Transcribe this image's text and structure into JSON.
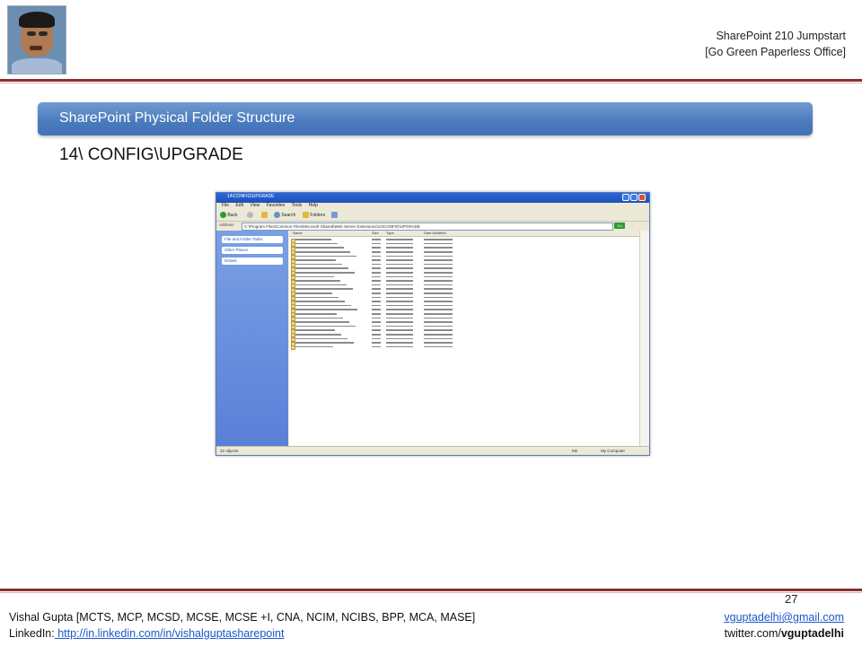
{
  "header": {
    "title_line1": "SharePoint 210 Jumpstart",
    "title_line2": "[Go Green Paperless Office]"
  },
  "slide": {
    "banner": "SharePoint Physical Folder Structure",
    "subheading": "14\\ CONFIG\\UPGRADE"
  },
  "explorer": {
    "title": "14\\CONFIG\\UPGRADE",
    "menu": [
      "File",
      "Edit",
      "View",
      "Favorites",
      "Tools",
      "Help"
    ],
    "toolbar": {
      "back": "Back",
      "search": "Search",
      "folders": "Folders"
    },
    "address_label": "Address",
    "address": "C:\\Program Files\\Common Files\\Microsoft Shared\\Web Server Extensions\\14\\CONFIG\\UPGRADE",
    "go_label": "Go",
    "tasks": [
      "File and Folder Tasks",
      "Other Places",
      "Details"
    ],
    "columns": [
      "Name",
      "Size",
      "Type",
      "Date Modified"
    ],
    "status_left": "22 objects",
    "status_mid": "KB",
    "status_right": "My Computer"
  },
  "footer": {
    "page_number": "27",
    "name_line": "Vishal Gupta [MCTS, MCP, MCSD, MCSE, MCSE +I, CNA, NCIM, NCIBS, BPP, MCA, MASE]",
    "linkedin_label": "LinkedIn:",
    "linkedin_url": " http://in.linkedin.com/in/vishalguptasharepoint",
    "email": "vguptadelhi@gmail.com",
    "twitter_prefix": "twitter.com/",
    "twitter_handle": "vguptadelhi"
  },
  "colors": {
    "rule": "#8b2f2f",
    "banner": "#4a7abd",
    "link": "#1a56c8"
  }
}
